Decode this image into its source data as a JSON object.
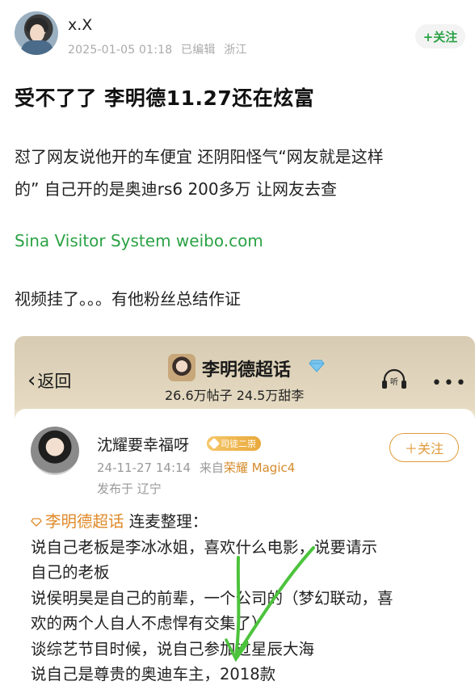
{
  "post": {
    "author": "x.X",
    "date": "2025-01-05 01:18",
    "edited": "已编辑",
    "location": "浙江",
    "follow_label": "+关注",
    "title": "受不了了 李明德11.27还在炫富",
    "body_line1": "怼了网友说他开的车便宜 还阴阳怪气“网友就是这样",
    "body_line2": "的” 自己开的是奥迪rs6 200多万 让网友去查",
    "link_text": "Sina Visitor System weibo.com",
    "note": "视频挂了。。。有他粉丝总结作证"
  },
  "embed": {
    "back_label": "返回",
    "supertopic_title": "李明德超话",
    "stats": "26.6万帖子 24.5万甜李",
    "listen_icon": "listen-icon",
    "more_icon": "more-icon",
    "card": {
      "name": "沈耀要幸福呀",
      "badge": "司徒二崇",
      "follow_label": "＋关注",
      "datetime": "24-11-27 14:14",
      "from_prefix": "来自",
      "device": "荣耀 Magic4",
      "location": "发布于 辽宁",
      "topic": "李明德超话",
      "topic_suffix": " 连麦整理：",
      "lines": [
        "说自己老板是李冰冰姐，喜欢什么电影，说要请示",
        "自己的老板",
        "说侯明昊是自己的前辈，一个公司的（梦幻联动，喜",
        "欢的两个人自人不虑悍有交集了）",
        "谈综艺节目时候，说自己参加过星辰大海",
        "说自己是尊贵的奥迪车主，2018款"
      ]
    }
  },
  "colors": {
    "accent_green": "#2ba245",
    "accent_orange": "#e09a3a",
    "meta_gray": "#aaaaaa"
  }
}
